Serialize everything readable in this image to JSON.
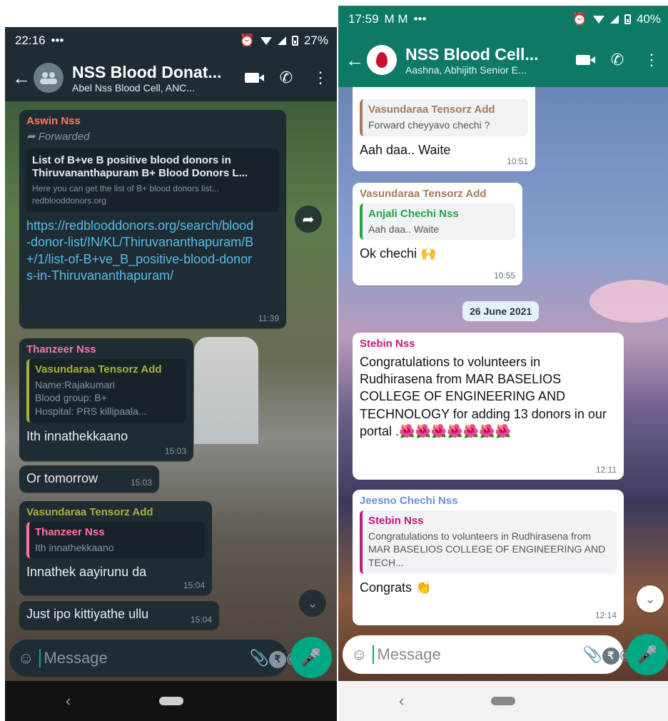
{
  "left": {
    "status": {
      "time": "22:16",
      "icons_left": "•••",
      "battery": "27%"
    },
    "header": {
      "title": "NSS Blood Donat...",
      "subtitle": "Abel Nss Blood Cell, ANC..."
    },
    "messages": {
      "forwarded": {
        "sender": "Aswin Nss",
        "label": "Forwarded",
        "preview_title": "List of B+ve B positive blood donors in Thiruvananthapuram B+ Blood Donors L...",
        "preview_desc": "Here you can get the list of B+ blood donors list...",
        "preview_domain": "redblooddonors.org",
        "link": "https://redblooddonors.org/search/blood-donor-list/IN/KL/Thiruvananthapuram/B+/1/list-of-B+ve_B_positive-blood-donors-in-Thiruvananthapuram/",
        "time": "11:39"
      },
      "thanzeer": {
        "sender": "Thanzeer Nss",
        "quote_name": "Vasundaraa Tensorz Add",
        "quote_text": "Name:Rajakumari\nBlood group: B+\nHospital: PRS killipaala...",
        "text": "Ith innathekkaano",
        "time": "15:03"
      },
      "tomorrow": {
        "text": "Or tomorrow",
        "time": "15:03"
      },
      "vasundaraa": {
        "sender": "Vasundaraa Tensorz Add",
        "quote_name": "Thanzeer Nss",
        "quote_text": "Ith innathekkaano",
        "text": "Innathek aayirunu da",
        "time": "15:04"
      },
      "ipo": {
        "text": "Just ipo kittiyathe ullu",
        "time": "15:04"
      }
    },
    "input": {
      "placeholder": "Message"
    },
    "colors": {
      "thanzeer": "#ff72a1",
      "aswin": "#ff7a59",
      "vasundaraa": "#a5b337",
      "link": "#53bdeb"
    }
  },
  "right": {
    "status": {
      "time": "17:59",
      "icons_left": "•••",
      "battery": "40%"
    },
    "header": {
      "title": "NSS Blood Cell...",
      "subtitle": "Aashna, Abhijith Senior E..."
    },
    "messages": {
      "m1": {
        "quote_name": "Vasundaraa Tensorz Add",
        "quote_text": "Forward cheyyavo chechi ?",
        "text": "Aah daa.. Waite",
        "time": "10:51"
      },
      "m2": {
        "sender": "Vasundaraa Tensorz Add",
        "quote_name": "Anjali Chechi Nss",
        "quote_text": "Aah daa.. Waite",
        "text": "Ok chechi",
        "time": "10:55"
      },
      "date": "26 June 2021",
      "m3": {
        "sender": "Stebin Nss",
        "text": "Congratulations to volunteers in Rudhirasena from MAR BASELIOS COLLEGE OF ENGINEERING AND TECHNOLOGY for adding 13 donors in our portal .",
        "emojis": "🌺🌺🌺🌺🌺🌺🌺",
        "time": "12:11"
      },
      "m4": {
        "sender": "Jeesno Chechi Nss",
        "quote_name": "Stebin Nss",
        "quote_text": "Congratulations to volunteers in Rudhirasena from MAR BASELIOS COLLEGE OF ENGINEERING AND TECH...",
        "text": "Congrats",
        "time": "12:14"
      }
    },
    "input": {
      "placeholder": "Message"
    },
    "colors": {
      "vasundaraa": "#a57b5a",
      "anjali": "#25a244",
      "stebin": "#c2187a",
      "jeesno": "#6b8fd6"
    }
  }
}
